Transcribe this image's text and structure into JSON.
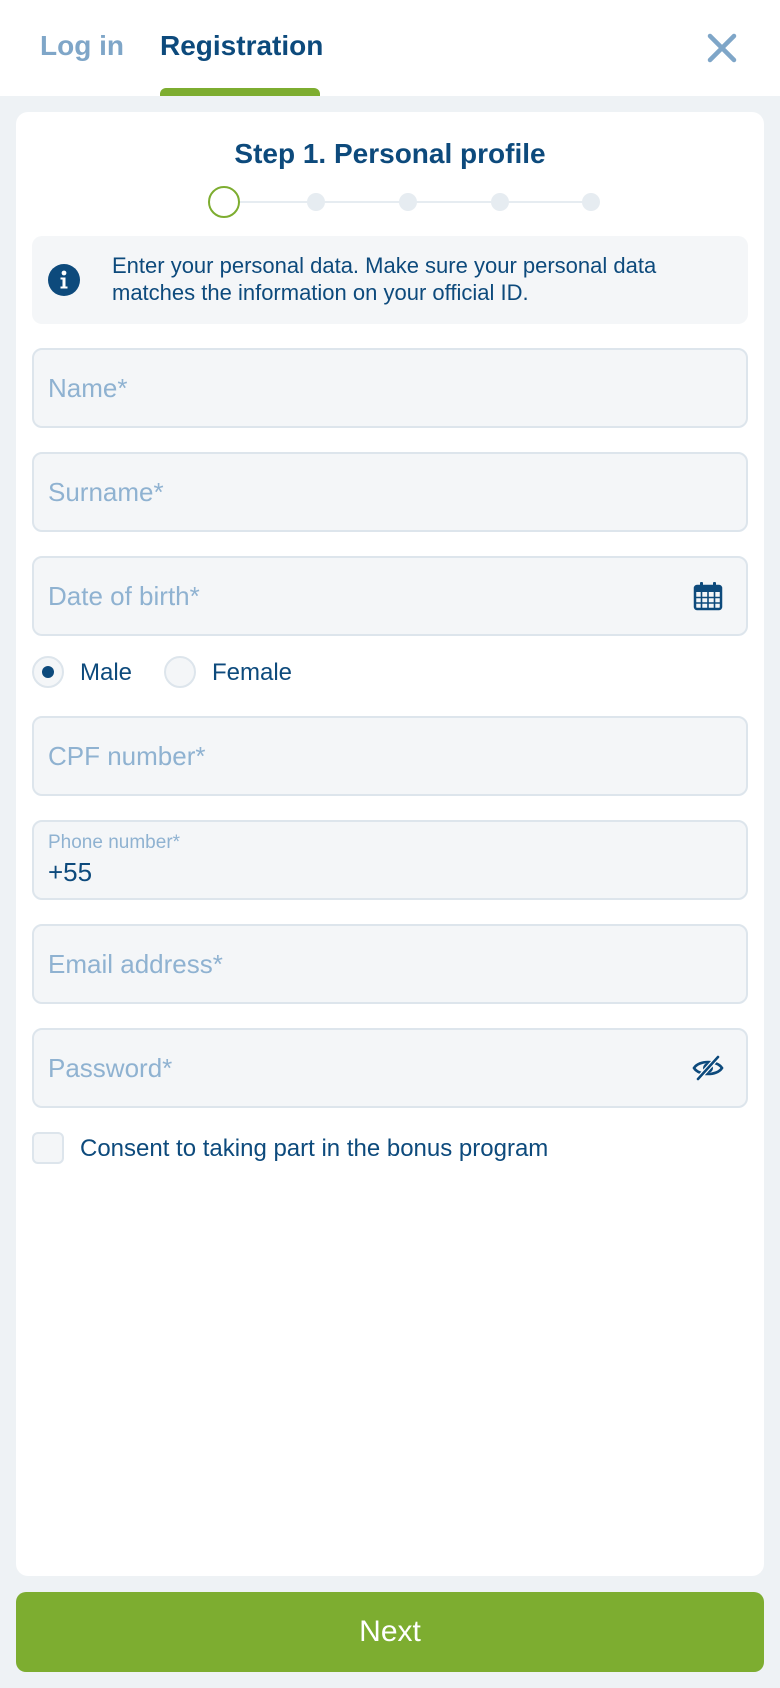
{
  "tabs": {
    "login": "Log in",
    "registration": "Registration"
  },
  "step": {
    "title": "Step 1. Personal profile",
    "current": 1,
    "total": 5
  },
  "info": {
    "text": "Enter your personal data. Make sure your personal data matches the information on your official ID."
  },
  "form": {
    "name_placeholder": "Name*",
    "surname_placeholder": "Surname*",
    "dob_placeholder": "Date of birth*",
    "gender": {
      "male": "Male",
      "female": "Female",
      "selected": "Male"
    },
    "cpf_placeholder": "CPF number*",
    "phone_label": "Phone number*",
    "phone_value": "+55",
    "email_placeholder": "Email address*",
    "password_placeholder": "Password*",
    "bonus_consent": "Consent to taking part in the bonus program",
    "bonus_checked": false
  },
  "next_button": "Next",
  "colors": {
    "primary": "#0d4a7c",
    "accent": "#7dad30",
    "muted": "#8fb2d1"
  },
  "icons": {
    "close": "close-icon",
    "info": "info-icon",
    "calendar": "calendar-icon",
    "password_toggle": "eye-slash-icon"
  }
}
